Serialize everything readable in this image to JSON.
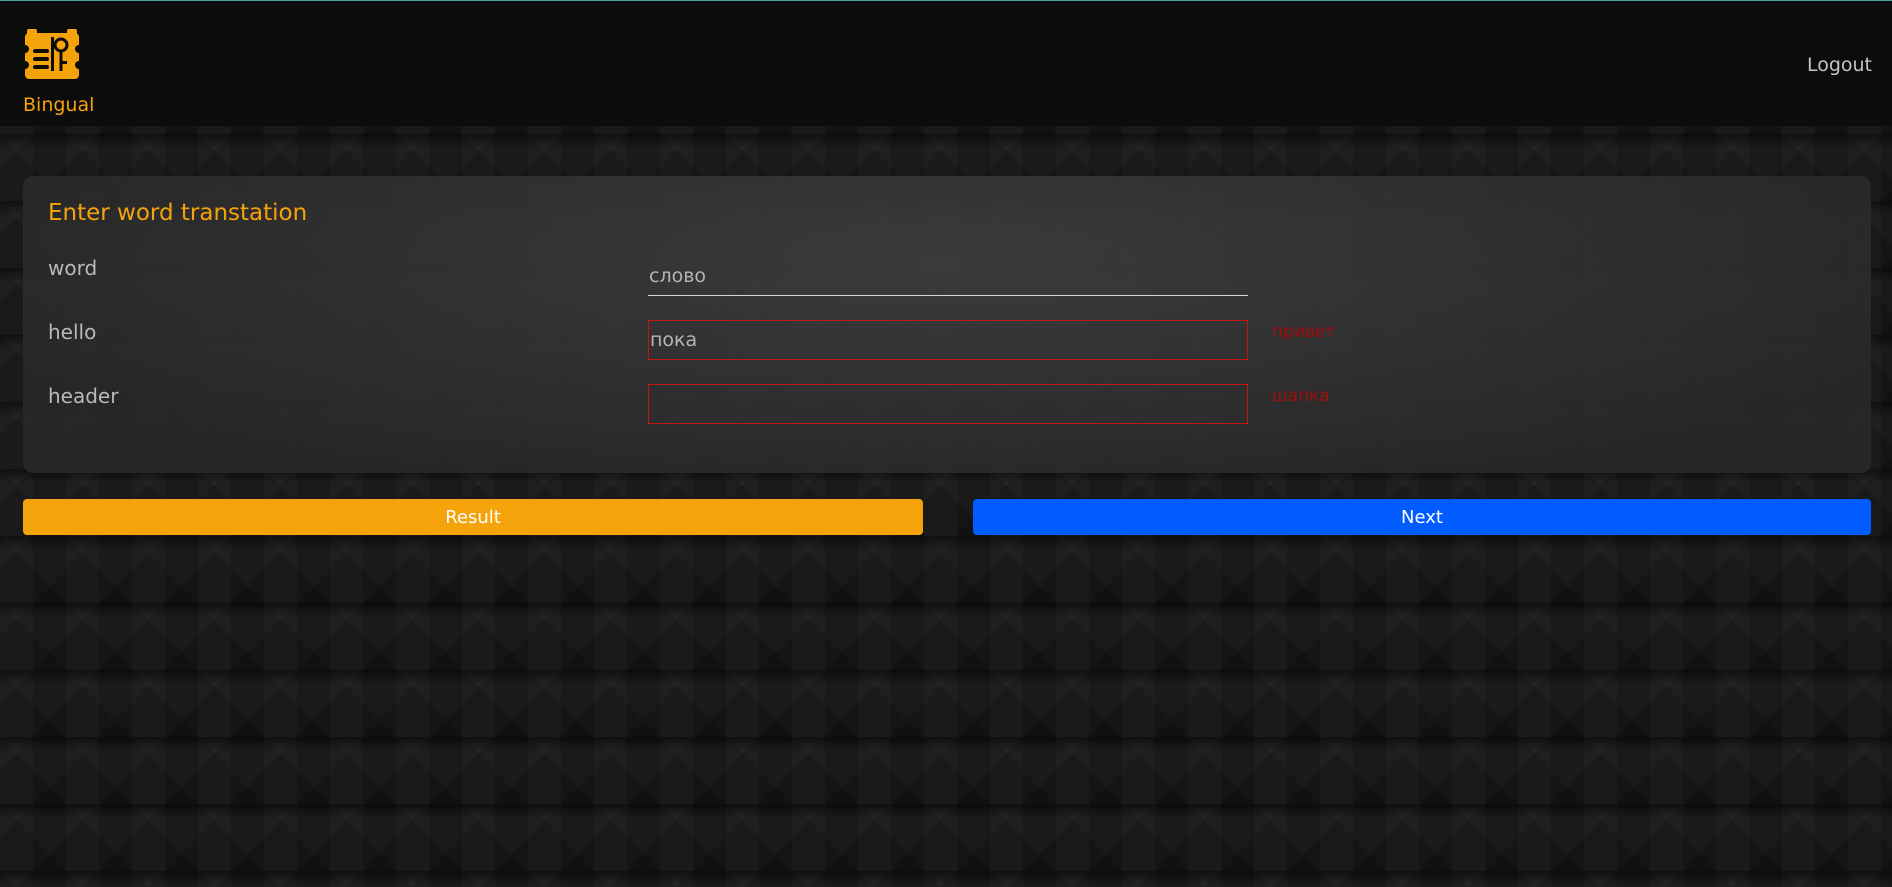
{
  "colors": {
    "accent": "#f5a30a",
    "primary": "#005cff",
    "error": "#c01818",
    "error_text": "#a00d0d"
  },
  "header": {
    "brand_name": "Bingual",
    "logo_icon": "bingual-logo-icon",
    "logout_label": "Logout"
  },
  "card": {
    "title": "Enter word transtation",
    "rows": [
      {
        "word": "word",
        "value": "слово",
        "hint": ""
      },
      {
        "word": "hello",
        "value": "пока",
        "hint": "привет"
      },
      {
        "word": "header",
        "value": "",
        "hint": "шапка"
      }
    ]
  },
  "actions": {
    "result_label": "Result",
    "next_label": "Next"
  }
}
